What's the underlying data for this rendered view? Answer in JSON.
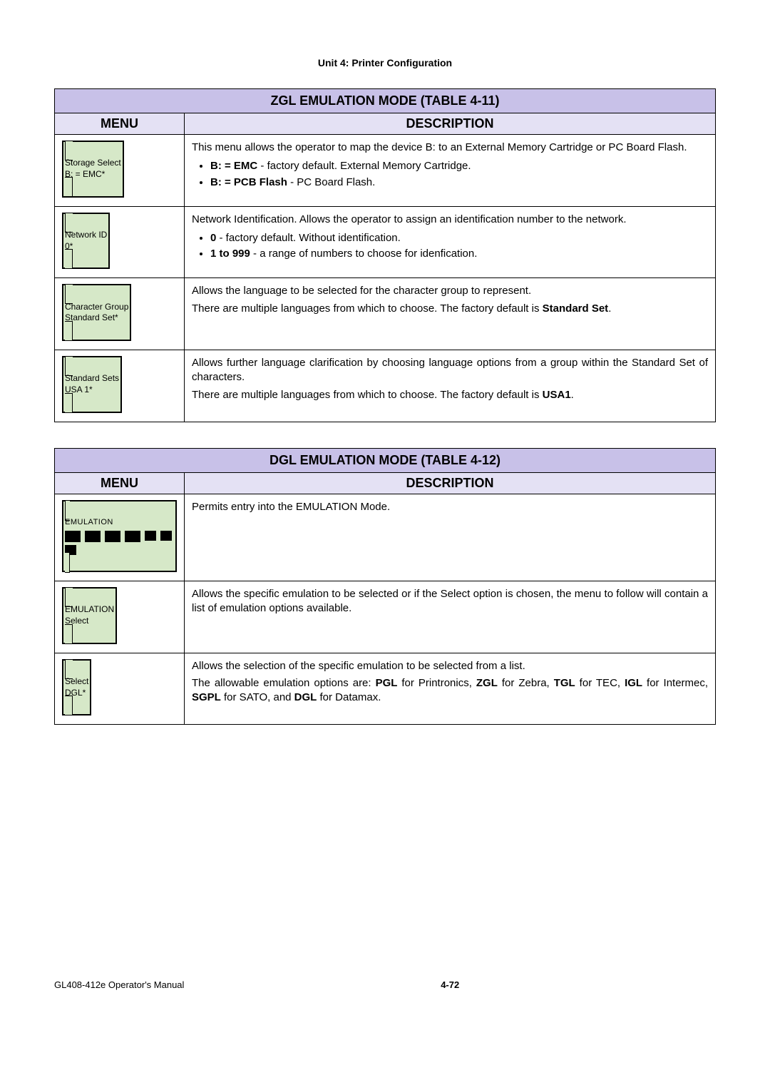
{
  "unit_header": "Unit 4:  Printer Configuration",
  "table_a": {
    "title": "ZGL EMULATION MODE (TABLE 4-11)",
    "menu_head": "MENU",
    "desc_head": "DESCRIPTION",
    "rows": [
      {
        "menu_line1": "Storage Select",
        "menu_line2": "B:  =  EMC*",
        "desc_intro": "This menu allows the operator to map the device B: to an External Memory Cartridge or PC Board Flash.",
        "opt1_b": "B: = EMC",
        "opt1_t": " - factory default. External Memory Cartridge.",
        "opt2_b": "B: = PCB Flash",
        "opt2_t": " - PC Board Flash."
      },
      {
        "menu_line1": "Network ID",
        "menu_line2": "0*",
        "desc_intro": "Network Identification. Allows the operator to assign an identification number to the network.",
        "opt1_b": "0",
        "opt1_t": " - factory default. Without identification.",
        "opt2_b": "1 to 999",
        "opt2_t": " - a range of numbers to choose for idenfication."
      },
      {
        "menu_line1": "Character Group",
        "menu_line2": "Standard Set*",
        "desc_line1": "Allows the language to be selected for the character group to represent.",
        "desc_line2_a": "There are multiple languages from which to choose. The factory default is ",
        "desc_line2_b": "Standard Set",
        "desc_line2_c": "."
      },
      {
        "menu_line1": "Standard Sets",
        "menu_line2": "USA 1*",
        "desc_line1": "Allows further language clarification by choosing language options from a group within the Standard Set of characters.",
        "desc_line2_a": "There are multiple languages from which to choose. The factory default is ",
        "desc_line2_b": "USA1",
        "desc_line2_c": "."
      }
    ]
  },
  "table_b": {
    "title": "DGL EMULATION MODE (TABLE 4-12)",
    "menu_head": "MENU",
    "desc_head": "DESCRIPTION",
    "rows": [
      {
        "emu_title": "EMULATION",
        "icons": [
          "",
          "",
          "",
          "",
          "",
          "",
          "",
          "",
          ""
        ],
        "desc": "Permits entry into the EMULATION Mode."
      },
      {
        "menu_line1": "EMULATION",
        "menu_line2": "Select",
        "desc": "Allows the specific emulation to be selected or if the Select option is chosen, the menu to follow will contain a list of emulation options available."
      },
      {
        "menu_line1": "Select",
        "menu_line2": "DGL*",
        "desc_line1": "Allows the selection of the specific emulation to be selected from a list.",
        "desc_line2_a": "The allowable emulation options are: ",
        "b1": "PGL",
        "t1": " for Printronics, ",
        "b2": "ZGL",
        "t2": " for Zebra, ",
        "b3": "TGL",
        "t3": " for TEC, ",
        "b4": "IGL",
        "t4": " for Intermec, ",
        "b5": "SGPL",
        "t5": " for SATO, and ",
        "b6": "DGL",
        "t6": " for Datamax."
      }
    ]
  },
  "footer_left": "GL408-412e Operator's Manual",
  "footer_center": "4-72"
}
